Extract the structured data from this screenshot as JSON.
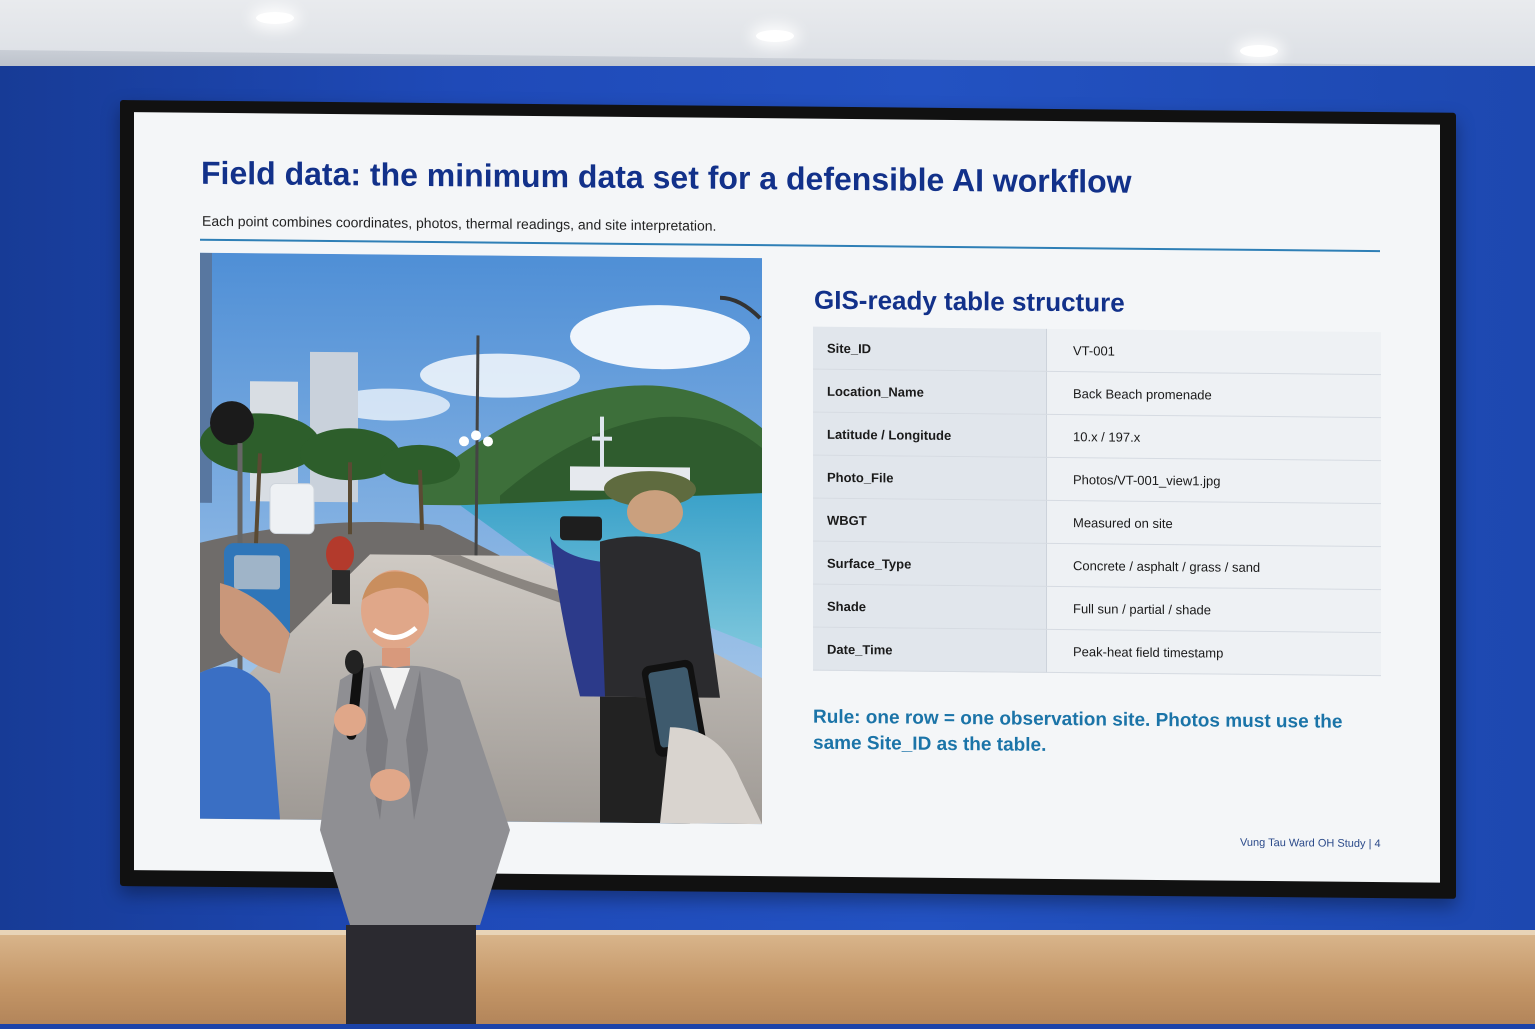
{
  "slide": {
    "title": "Field data: the minimum data set for a defensible AI workflow",
    "subtitle": "Each point combines coordinates, photos, thermal readings, and site interpretation.",
    "table_heading": "GIS-ready table structure",
    "table": [
      {
        "field": "Site_ID",
        "value": "VT-001"
      },
      {
        "field": "Location_Name",
        "value": "Back Beach promenade"
      },
      {
        "field": "Latitude / Longitude",
        "value": "10.x / 197.x"
      },
      {
        "field": "Photo_File",
        "value": "Photos/VT-001_view1.jpg"
      },
      {
        "field": "WBGT",
        "value": "Measured on site"
      },
      {
        "field": "Surface_Type",
        "value": "Concrete / asphalt / grass / sand"
      },
      {
        "field": "Shade",
        "value": "Full sun / partial / shade"
      },
      {
        "field": "Date_Time",
        "value": "Peak-heat field timestamp"
      }
    ],
    "rule": "Rule: one row = one observation site. Photos must use the same Site_ID as the table.",
    "footer": "Vung Tau Ward OH Study  |  4"
  },
  "colors": {
    "wall": "#1f4ab8",
    "title": "#12318a",
    "rule_text": "#1b74a8"
  }
}
